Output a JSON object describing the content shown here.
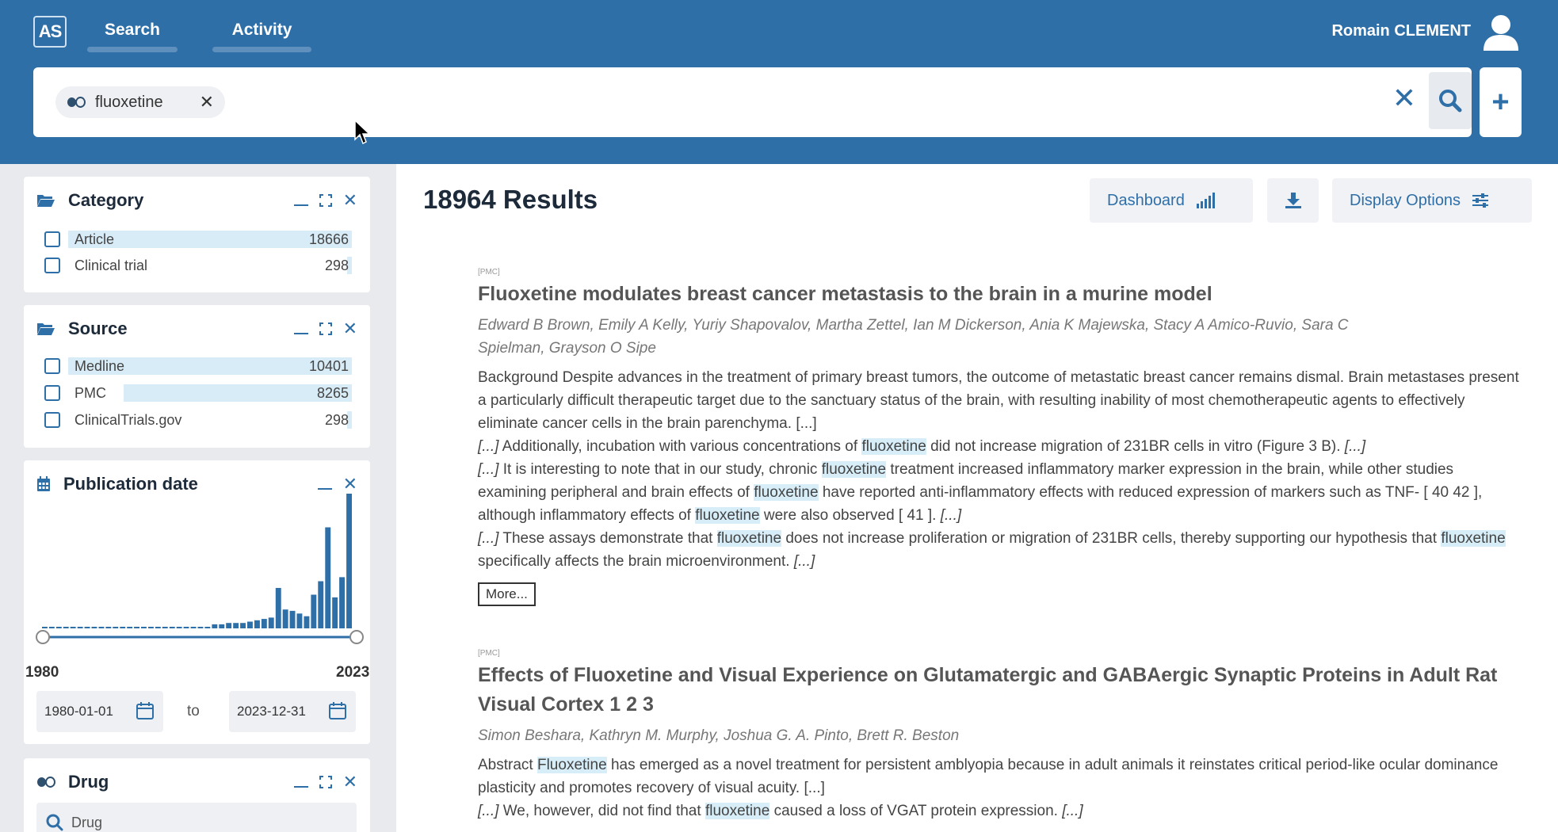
{
  "header": {
    "logo": "AS",
    "tabs": [
      {
        "label": "Search",
        "active": true
      },
      {
        "label": "Activity",
        "active": false
      }
    ],
    "user_name": "Romain CLEMENT"
  },
  "search": {
    "chip_label": "fluoxetine",
    "chip_icon": "pill-icon"
  },
  "filters": {
    "category": {
      "title": "Category",
      "items": [
        {
          "label": "Article",
          "count": "18666",
          "share": 1.0
        },
        {
          "label": "Clinical trial",
          "count": "298",
          "share": 0.016
        }
      ]
    },
    "source": {
      "title": "Source",
      "items": [
        {
          "label": "Medline",
          "count": "10401",
          "share": 1.0
        },
        {
          "label": "PMC",
          "count": "8265",
          "share": 0.8
        },
        {
          "label": "ClinicalTrials.gov",
          "count": "298",
          "share": 0.03
        }
      ]
    },
    "publication_date": {
      "title": "Publication date",
      "range_min": "1980",
      "range_max": "2023",
      "from_value": "1980-01-01",
      "to_label": "to",
      "to_value": "2023-12-31",
      "histogram": [
        1,
        1,
        1,
        1,
        1,
        1,
        1,
        1,
        1,
        1,
        1,
        1,
        1,
        1,
        1,
        1,
        1,
        1,
        1,
        1,
        1,
        1,
        1,
        1,
        3,
        3,
        4,
        4,
        4,
        5,
        6,
        7,
        8,
        30,
        14,
        13,
        11,
        9,
        25,
        35,
        75,
        23,
        38,
        100
      ]
    },
    "drug": {
      "title": "Drug",
      "search_placeholder": "Drug"
    }
  },
  "results": {
    "count_label": "18964 Results",
    "toolbar": {
      "dashboard_label": "Dashboard",
      "display_options_label": "Display Options"
    },
    "items": [
      {
        "source": "[PMC]",
        "title": "Fluoxetine modulates breast cancer metastasis to the brain in a murine model",
        "authors_line1": "Edward B Brown, Emily A Kelly, Yuriy Shapovalov, Martha Zettel, Ian M Dickerson, Ania K Majewska, Stacy A Amico-Ruvio, Sara C",
        "authors_line2": "Spielman, Grayson O Sipe",
        "para1": "Background Despite advances in the treatment of primary breast tumors, the outcome of metastatic breast cancer remains dismal. Brain metastases present a particularly difficult therapeutic target due to the sanctuary status of the brain, with resulting inability of most chemotherapeutic agents to effectively eliminate cancer cells in the brain parenchyma.",
        "ellipsis": "[...]",
        "p2a": "Additionally, incubation with various concentrations of",
        "term": "fluoxetine",
        "p2b": "did not increase migration of 231BR cells in vitro (Figure 3 B).",
        "p3a": "It is interesting to note that in our study, chronic",
        "p3b": "treatment increased inflammatory marker expression in the brain, while other studies examining peripheral and brain effects of",
        "p3c": "have reported anti-inflammatory effects with reduced expression of markers such as TNF- [ 40 42 ], although inflammatory effects of",
        "p3d": "were also observed [ 41 ].",
        "p4a": "These assays demonstrate that",
        "p4b": "does not increase proliferation or migration of 231BR cells, thereby supporting our hypothesis that",
        "p4c": "specifically affects the brain microenvironment.",
        "more_label": "More..."
      },
      {
        "source": "[PMC]",
        "title": "Effects of Fluoxetine and Visual Experience on Glutamatergic and GABAergic Synaptic Proteins in Adult Rat Visual Cortex 1 2 3",
        "authors": "Simon Beshara, Kathryn M. Murphy, Joshua G. A. Pinto, Brett R. Beston",
        "p1a": "Abstract",
        "term_cap": "Fluoxetine",
        "p1b": "has emerged as a novel treatment for persistent amblyopia because in adult animals it reinstates critical period-like ocular dominance plasticity and promotes recovery of visual acuity.",
        "ellipsis": "[...]",
        "p2a": "We, however, did not find that",
        "term": "fluoxetine",
        "p2b": "caused a loss of VGAT protein expression."
      }
    ]
  },
  "colors": {
    "brand": "#2f6fa8",
    "highlight": "#d7eef9",
    "bar": "#2f6fa8"
  }
}
